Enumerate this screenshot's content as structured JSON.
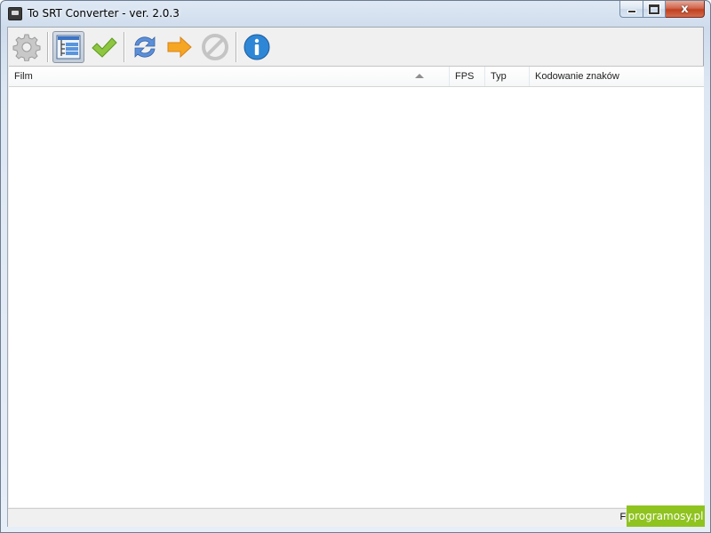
{
  "window": {
    "title": "To SRT Converter - ver. 2.0.3",
    "caption": {
      "minimize": "",
      "maximize": "",
      "close": "x"
    }
  },
  "toolbar": {
    "buttons": [
      {
        "name": "settings-button",
        "icon": "gear-icon"
      },
      {
        "name": "list-view-button",
        "icon": "tree-list-icon",
        "active": true
      },
      {
        "name": "check-button",
        "icon": "checkmark-icon"
      },
      {
        "name": "refresh-button",
        "icon": "refresh-icon"
      },
      {
        "name": "convert-button",
        "icon": "arrow-right-icon"
      },
      {
        "name": "stop-button",
        "icon": "stop-icon"
      },
      {
        "name": "about-button",
        "icon": "info-icon"
      }
    ]
  },
  "list": {
    "columns": [
      "Film",
      "FPS",
      "Typ",
      "Kodowanie znaków"
    ],
    "rows": []
  },
  "status": {
    "text": "Filmy: 0,"
  },
  "watermark": {
    "text": "programosy.pl"
  }
}
